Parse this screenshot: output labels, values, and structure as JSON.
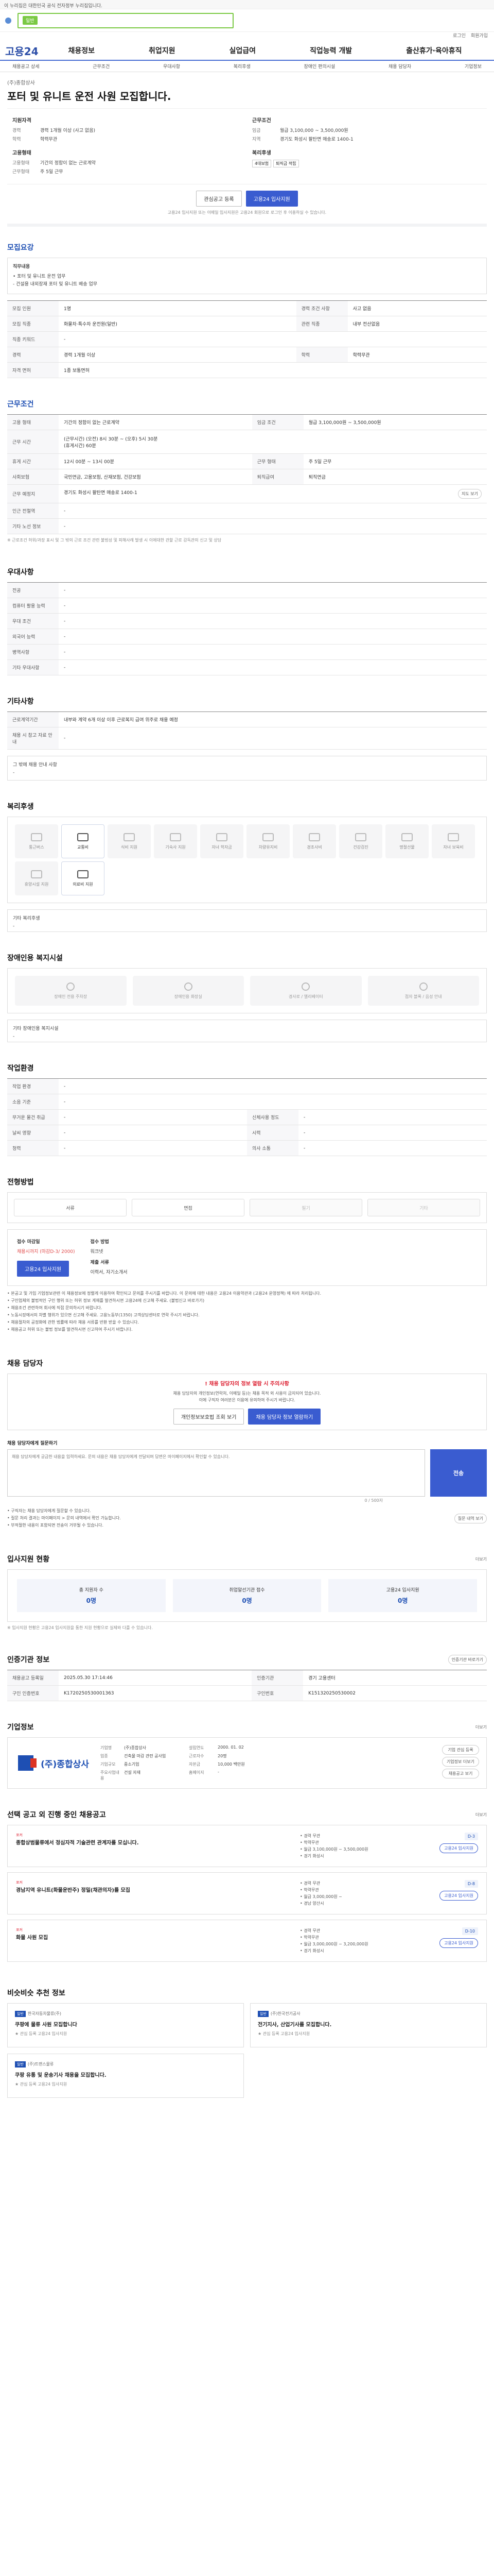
{
  "gov_banner": "이 누리집은 대한민국 공식 전자정부 누리집입니다.",
  "search": {
    "tag": "일반",
    "placeholder": ""
  },
  "util": [
    "로그인",
    "회원가입"
  ],
  "brand": "고용24",
  "gnb": [
    "채용정보",
    "취업지원",
    "실업급여",
    "직업능력 개발",
    "출산휴가·육아휴직"
  ],
  "subnav": [
    "채용공고 상세",
    "근무조건",
    "우대사항",
    "복리후생",
    "장애인 편의시설",
    "채용 담당자",
    "기업정보"
  ],
  "job": {
    "company": "(주)종합상사",
    "title": "포터 및 유니트 운전 사원 모집합니다."
  },
  "summary": {
    "left_title": "지원자격",
    "left_rows": [
      {
        "k": "경력",
        "v": "경력 1개월 이상 (사고 없음)"
      },
      {
        "k": "학력",
        "v": "학력무관"
      }
    ],
    "left_title2": "고용형태",
    "left_rows2": [
      {
        "k": "고용형태",
        "v": "기간의 정함이 없는 근로계약"
      },
      {
        "k": "근무형태",
        "v": "주 5일 근무"
      }
    ],
    "right_title": "근무조건",
    "right_rows": [
      {
        "k": "임금",
        "v": "월급 3,100,000 ~ 3,500,000원"
      },
      {
        "k": "지역",
        "v": "경기도 화성시 팔탄면 매송로 1400-1"
      }
    ],
    "right_title2": "복리후생",
    "right_tags": [
      "4대보험",
      "퇴직금 적립"
    ]
  },
  "cta": {
    "interest": "관심공고 등록",
    "apply": "고용24 입사지원",
    "note": "고용24 입사지원 또는 이메일 입사지원은 고용24 회원으로 로그인 후 이용하실 수 있습니다."
  },
  "sec_desc": {
    "title": "모집요강",
    "body_title": "직무내용",
    "body": "• 포터 및 유니트 운전 업무",
    "body2": "- 건설용 내외장재 포터 및 유니트 배송 업무"
  },
  "recruit": {
    "rows": [
      [
        "모집 인원",
        "1명",
        "경력 조건 사항",
        "사고 없음"
      ],
      [
        "모집 직종",
        "화물차·특수차 운전원(일반)",
        "관련 직종",
        "내부 전산없음"
      ],
      [
        "직종 키워드",
        "-",
        "",
        ""
      ],
      [
        "경력",
        "경력 1개월 이상",
        "학력",
        "학력무관"
      ],
      [
        "자격 면허",
        "1종 보통면허",
        "",
        ""
      ]
    ]
  },
  "conditions": {
    "title": "근무조건",
    "rows": [
      [
        "고용 형태",
        "기간의 정함이 없는 근로계약",
        "임금 조건",
        "월급 3,100,000원 ~ 3,500,000원"
      ],
      [
        "근무 시간",
        "(근무시간) (오전) 8시 30분 ~ (오후) 5시 30분\n(휴게시간) 60분",
        "",
        ""
      ],
      [
        "휴게 시간",
        "12시 00분 ~ 13시 00분",
        "근무 형태",
        "주 5일 근무"
      ],
      [
        "사회보험",
        "국민연금, 고용보험, 산재보험, 건강보험",
        "퇴직급여",
        "퇴직연금"
      ],
      [
        "근무 예정지",
        "경기도 화성시 팔탄면 매송로 1400-1",
        "",
        ""
      ],
      [
        "인근 전철역",
        "-",
        "",
        ""
      ],
      [
        "기타 노선 정보",
        "-",
        "",
        ""
      ]
    ],
    "map_btn": "지도 보기",
    "note": "※ 근로조건 허위/과장 표시 및 그 밖의 근로 조건 관련 불법성 및 피해사례 발생 시 이에대한 관할 근로 감독관의 신고 및 상담"
  },
  "preference": {
    "title": "우대사항",
    "rows": [
      [
        "전공",
        "-"
      ],
      [
        "컴퓨터 활용 능력",
        "-"
      ],
      [
        "우대 조건",
        "-"
      ],
      [
        "외국어 능력",
        "-"
      ],
      [
        "병역사항",
        "-"
      ],
      [
        "기타 우대사항",
        "-"
      ]
    ]
  },
  "etc": {
    "title": "기타사항",
    "rows": [
      [
        "근로계약기간",
        "내부와 계약 6개 이상 이후 근로복지 급여 위주로 채용 예정"
      ],
      [
        "채용 시 참고 자료 안내",
        "-"
      ]
    ],
    "sub": "그 밖에 채용 안내 사항",
    "sub_v": "-"
  },
  "welfare": {
    "title": "복리후생",
    "items": [
      {
        "name": "통근버스",
        "on": false
      },
      {
        "name": "교통비",
        "on": true
      },
      {
        "name": "식비 지원",
        "on": false
      },
      {
        "name": "기숙사 지원",
        "on": false
      },
      {
        "name": "자녀 학자금",
        "on": false
      },
      {
        "name": "차량유지비",
        "on": false
      },
      {
        "name": "경조사비",
        "on": false
      },
      {
        "name": "건강검진",
        "on": false
      },
      {
        "name": "명절선물",
        "on": false
      },
      {
        "name": "자녀 보육비",
        "on": false
      },
      {
        "name": "휴양시설 지원",
        "on": false
      },
      {
        "name": "의료비 지원",
        "on": true
      }
    ],
    "other_label": "기타 복리후생",
    "other_v": "-"
  },
  "accessibility": {
    "title": "장애인용 복지시설",
    "items": [
      "장애인 전용 주차장",
      "장애인용 화장실",
      "경사로 / 엘리베이터",
      "점자 블록 / 음성 안내"
    ],
    "other_label": "기타 장애인용 복지시설",
    "other_v": "-"
  },
  "workplace": {
    "title": "작업환경",
    "rows": [
      [
        "작업 환경",
        "-",
        "",
        ""
      ],
      [
        "소음 기준",
        "-",
        "",
        ""
      ],
      [
        "무거운 물건 취급",
        "-",
        "신체사용 정도",
        "-"
      ],
      [
        "날씨 영향",
        "-",
        "시력",
        "-"
      ],
      [
        "청력",
        "-",
        "의사 소통",
        "-"
      ]
    ]
  },
  "process": {
    "title": "전형방법",
    "steps": [
      {
        "label": "서류",
        "on": true
      },
      {
        "label": "면접",
        "on": true
      },
      {
        "label": "필기",
        "on": false
      },
      {
        "label": "기타",
        "on": false
      }
    ]
  },
  "apply": {
    "c1_title": "접수 마감일",
    "c1_v": "채용시까지 (마감D-3/ 2000)",
    "c1_btn": "고용24 입사지원",
    "c2_title": "접수 방법",
    "c2_v": "워크넷",
    "c3_title": "제출 서류",
    "c3_v": "이력서, 자기소개서",
    "bullets": [
      "• 본공고 및 가입 기업정보관련 이 채용정보에 정렬게 이용하여 확인되고 문의를 주시기를 바랍니다. 이 문의에 대한 내용은 고용24 이용약관과 (고용24 운영정책) 에 따라 처리됩니다.",
      "• 구인업체의 불법적인 구인 행위 또는 허위 정보 게재를 발견하시면 고용24에 신고해 주세요. (불법신고 바로가기)",
      "• 채용조건 관련하여 회사에 직접 문의하시기 바랍니다.",
      "• 노동시장에서의 차별 행위가 있으면 신고해 주세요. 고용노동부(1350) 고객상담센터로 연락 주시기 바랍니다.",
      "• 채용절차의 공정화에 관한 법률에 따라 채용 서류를 반환 받을 수 있습니다.",
      "• 채용공고 허위 또는 불법 정보를 발견하시면 신고하여 주시기 바랍니다."
    ]
  },
  "contact": {
    "title": "채용 담당자",
    "warn_title": "! 채용 담당자의 정보 열람 시 주의사항",
    "warn_p1": "채용 담당자의 개인정보(연락처, 이메일 등)는 채용 목적 외 사용이 금지되어 있습니다.",
    "warn_p2": "이에 구직자 여러분은 이용에 유의하여 주시기 바랍니다.",
    "btn1": "개인정보보호법 조회 보기",
    "btn2": "채용 담당자 정보 열람하기",
    "inq_label": "채용 담당자에게 질문하기",
    "inq_count": "0 / 500자",
    "inq_placeholder": "채용 담당자에게 궁금한 내용을 입력하세요. 문의 내용은 채용 담당자에게 전달되며 답변은 마이페이지에서 확인할 수 있습니다.",
    "send": "전송",
    "notes": [
      "• 구직자는 채용 담당자에게 질문할 수 있습니다.",
      "• 질문 처리 결과는 마이페이지 > 문의 내역에서 확인 가능합니다.",
      "• 부적절한 내용이 포함되면 전송이 거부될 수 있습니다."
    ],
    "hist_btn": "질문 내역 보기"
  },
  "stats": {
    "title": "입사지원 현황",
    "more": "더보기",
    "items": [
      {
        "label": "총 지원자 수",
        "v": "0명"
      },
      {
        "label": "취업알선기관 접수",
        "v": "0명"
      },
      {
        "label": "고용24 입사지원",
        "v": "0명"
      }
    ],
    "note": "※ 입사지원 현황은 고용24 입사지원을 통한 지원 현황으로 실제와 다를 수 있습니다."
  },
  "cert": {
    "title": "인증기관 정보",
    "btn": "인증기관 바로가기",
    "rows": [
      [
        "채용공고 등록일",
        "2025.05.30 17:14:46",
        "인증기관",
        "경기 고용센터"
      ],
      [
        "구인 인증번호",
        "K1720250530001363",
        "구인번호",
        "K151320250530002"
      ]
    ]
  },
  "company": {
    "title": "기업정보",
    "more": "더보기",
    "logo": "(주)종합상사",
    "rows": [
      "기업명",
      "(주)종합상사",
      "설립연도",
      "2000. 01. 02",
      "업종",
      "건축물 마감 관련 공사업",
      "근로자수",
      "20명",
      "기업규모",
      "중소기업",
      "자본금",
      "10,000 백만원",
      "주요사업내용",
      "건설 자재",
      "홈페이지",
      "-"
    ],
    "side": [
      "기업 관심 등록",
      "기업정보 더보기",
      "채용공고 보기"
    ]
  },
  "related": {
    "title": "선택 공고 외 진행 중인 채용공고",
    "more": "더보기",
    "items": [
      {
        "tag": "포커",
        "title": "종합상범물류에서 정심자적 기술관련 관계자를 모십니다.",
        "meta": [
          "• 경력 무관",
          "• 학력무관",
          "• 월급 3,100,000원 ~ 3,500,000원",
          "• 경기 화성시"
        ],
        "dday": "D-3",
        "apply": "고용24 입사지원"
      },
      {
        "tag": "포커",
        "title": "경남지역 유니트(화물운반주) 정밀(채관의자)를 모집",
        "meta": [
          "• 경력 무관",
          "• 학력무관",
          "• 월급 3,000,000원 ~",
          "• 경남 양산시"
        ],
        "dday": "D-8",
        "apply": "고용24 입사지원"
      },
      {
        "tag": "포커",
        "title": "화물 사원 모집",
        "meta": [
          "• 경력 무관",
          "• 학력무관",
          "• 월급 3,000,000원 ~ 3,200,000원",
          "• 경기 화성시"
        ],
        "dday": "D-10",
        "apply": "고용24 입사지원"
      }
    ]
  },
  "recommend": {
    "title": "비슷비슷 추천 정보",
    "cards": [
      {
        "badge": "일반",
        "co": "한국자동차물류(주)",
        "title": "쿠팡에 물류 사원 모집합니다",
        "meta": "★ 관심 등록    고용24 입사지원"
      },
      {
        "badge": "일반",
        "co": "(주)한국전기공사",
        "title": "전기지사, 산업기사를 모집합니다.",
        "meta": "★ 관심 등록    고용24 입사지원"
      },
      {
        "badge": "일반",
        "co": "(주)트랜스물류",
        "title": "쿠팡 유통 및 운송기사 채용을 모집합니다.",
        "meta": "★ 관심 등록    고용24 입사지원"
      }
    ]
  }
}
